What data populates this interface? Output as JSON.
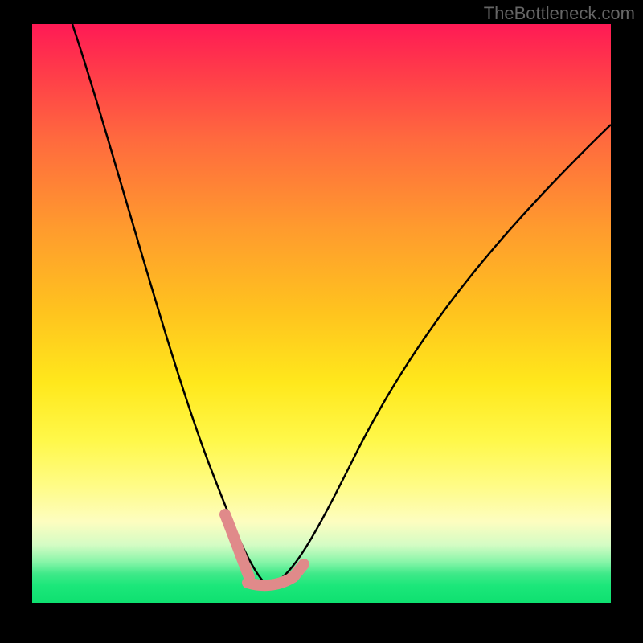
{
  "watermark": "TheBottleneck.com",
  "chart_data": {
    "type": "line",
    "title": "",
    "xlabel": "",
    "ylabel": "",
    "xlim": [
      0,
      100
    ],
    "ylim": [
      0,
      100
    ],
    "series": [
      {
        "name": "curve-left",
        "x": [
          7,
          10,
          13,
          16,
          19,
          22,
          25,
          27,
          29,
          31,
          33,
          34.5,
          36,
          37,
          38.5,
          40.5
        ],
        "y": [
          100,
          90,
          80,
          70,
          60,
          50,
          40,
          32,
          25,
          19,
          13,
          9,
          6,
          4,
          3.2,
          3
        ]
      },
      {
        "name": "curve-right",
        "x": [
          40.5,
          42,
          44,
          46,
          49,
          53,
          58,
          64,
          71,
          79,
          88,
          98
        ],
        "y": [
          3,
          4,
          6,
          9,
          14,
          21,
          30,
          40,
          51,
          62,
          73,
          83
        ]
      },
      {
        "name": "marker-band-left",
        "x": [
          33,
          34,
          35,
          36,
          37
        ],
        "y": [
          13,
          10,
          7,
          5,
          4
        ]
      },
      {
        "name": "marker-band-bottom",
        "x": [
          37,
          38,
          39,
          40,
          41,
          42,
          43,
          44,
          45
        ],
        "y": [
          3.2,
          3,
          3,
          3,
          3.2,
          3.5,
          4,
          5,
          6
        ]
      }
    ],
    "colors": {
      "curve": "#000000",
      "marker": "#e08a8a",
      "bg_top": "#ff1a55",
      "bg_mid": "#ffe81c",
      "bg_bottom": "#0ee070"
    }
  }
}
